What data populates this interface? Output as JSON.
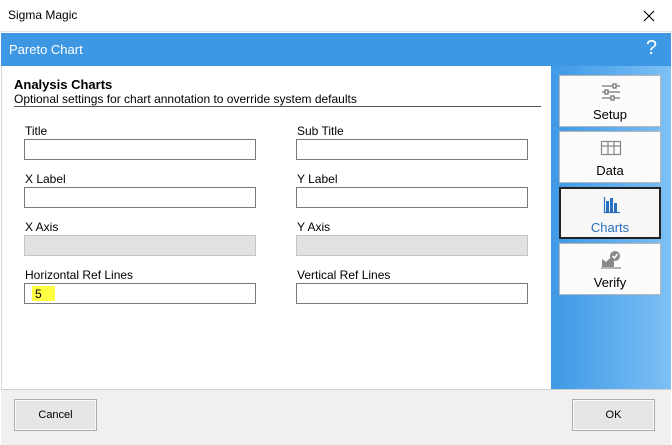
{
  "window": {
    "title": "Sigma Magic"
  },
  "header": {
    "title": "Pareto Chart",
    "help": "?"
  },
  "section": {
    "title": "Analysis Charts",
    "subtitle": "Optional settings for chart annotation to override system defaults"
  },
  "fields": {
    "title": {
      "label": "Title",
      "value": ""
    },
    "subtitle": {
      "label": "Sub Title",
      "value": ""
    },
    "xlabel": {
      "label": "X Label",
      "value": ""
    },
    "ylabel": {
      "label": "Y Label",
      "value": ""
    },
    "xaxis": {
      "label": "X Axis",
      "value": ""
    },
    "yaxis": {
      "label": "Y Axis",
      "value": ""
    },
    "hreflines": {
      "label": "Horizontal Ref Lines",
      "value": "5"
    },
    "vreflines": {
      "label": "Vertical Ref Lines",
      "value": ""
    }
  },
  "sidebar": {
    "items": [
      {
        "label": "Setup",
        "icon": "sliders-icon"
      },
      {
        "label": "Data",
        "icon": "table-icon"
      },
      {
        "label": "Charts",
        "icon": "bar-chart-icon",
        "active": true
      },
      {
        "label": "Verify",
        "icon": "verify-icon"
      }
    ]
  },
  "footer": {
    "cancel": "Cancel",
    "ok": "OK"
  },
  "colors": {
    "header": "#3d97e3",
    "highlight": "#ffff44",
    "active_label": "#2a6fc2"
  }
}
